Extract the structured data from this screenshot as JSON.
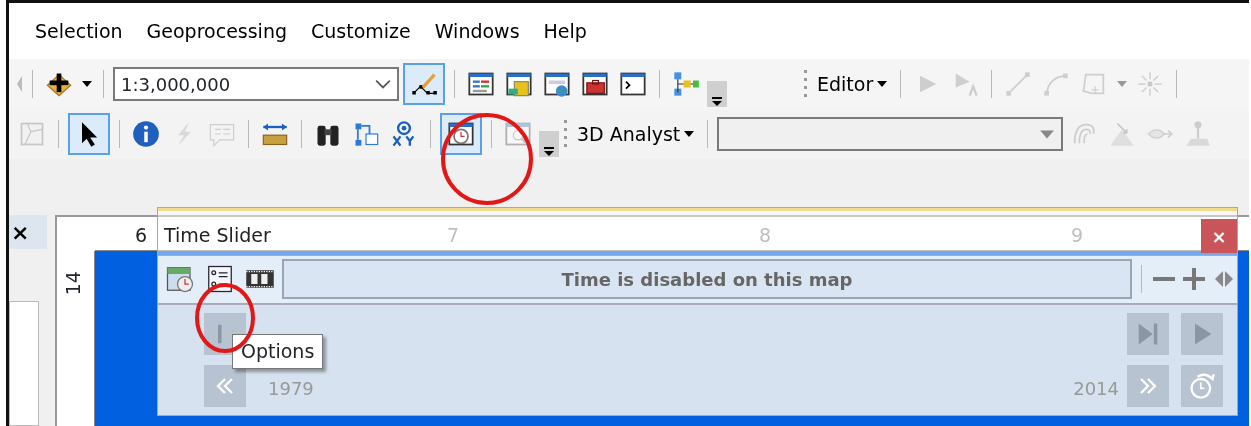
{
  "menu": [
    {
      "label": "Selection"
    },
    {
      "label": "Geoprocessing"
    },
    {
      "label": "Customize"
    },
    {
      "label": "Windows"
    },
    {
      "label": "Help"
    }
  ],
  "toolbar_row_1": [
    {
      "kind": "grip"
    },
    {
      "kind": "separator"
    },
    {
      "kind": "add",
      "selected": false,
      "disabled": false,
      "dropdown": true
    },
    {
      "kind": "separator"
    },
    {
      "kind": "combo",
      "value": "1:3,000,000",
      "disabled": false
    },
    {
      "kind": "edit",
      "selected": true,
      "disabled": false
    },
    {
      "kind": "separator"
    },
    {
      "kind": "toc",
      "selected": false,
      "disabled": false
    },
    {
      "kind": "catalog",
      "selected": false,
      "disabled": false
    },
    {
      "kind": "searchwin",
      "selected": false,
      "disabled": false
    },
    {
      "kind": "toolbox",
      "selected": false,
      "disabled": false
    },
    {
      "kind": "python",
      "selected": false,
      "disabled": false
    },
    {
      "kind": "separator"
    },
    {
      "kind": "model",
      "selected": false,
      "disabled": false
    },
    {
      "kind": "overflow"
    },
    {
      "kind": "gap"
    },
    {
      "kind": "handle"
    },
    {
      "kind": "menu",
      "label": "Editor"
    },
    {
      "kind": "separator"
    },
    {
      "kind": "editarrow",
      "selected": false,
      "disabled": true
    },
    {
      "kind": "annoarrow",
      "selected": false,
      "disabled": true
    },
    {
      "kind": "separator"
    },
    {
      "kind": "line",
      "selected": false,
      "disabled": true
    },
    {
      "kind": "trace",
      "selected": false,
      "disabled": true
    },
    {
      "kind": "polygon",
      "selected": false,
      "disabled": true,
      "dropdown": true
    },
    {
      "kind": "sparkle",
      "selected": false,
      "disabled": true
    },
    {
      "kind": "separator"
    }
  ],
  "toolbar_row_2": [
    {
      "kind": "frame",
      "selected": false,
      "disabled": true
    },
    {
      "kind": "separator"
    },
    {
      "kind": "select",
      "selected": true,
      "disabled": false
    },
    {
      "kind": "separator"
    },
    {
      "kind": "info",
      "selected": false,
      "disabled": false
    },
    {
      "kind": "flash",
      "selected": false,
      "disabled": true
    },
    {
      "kind": "popup",
      "selected": false,
      "disabled": true
    },
    {
      "kind": "separator"
    },
    {
      "kind": "measure",
      "selected": false,
      "disabled": false
    },
    {
      "kind": "separator"
    },
    {
      "kind": "find",
      "selected": false,
      "disabled": false
    },
    {
      "kind": "route",
      "selected": false,
      "disabled": false
    },
    {
      "kind": "xy",
      "selected": false,
      "disabled": false
    },
    {
      "kind": "separator"
    },
    {
      "kind": "timeslider",
      "selected": true,
      "disabled": false
    },
    {
      "kind": "separator"
    },
    {
      "kind": "viewer",
      "selected": false,
      "disabled": true
    },
    {
      "kind": "overflow"
    },
    {
      "kind": "handle"
    },
    {
      "kind": "menu",
      "label": "3D Analyst"
    },
    {
      "kind": "separator"
    },
    {
      "kind": "combo",
      "disabled": true
    },
    {
      "kind": "contour",
      "selected": false,
      "disabled": true
    },
    {
      "kind": "slope",
      "selected": false,
      "disabled": true
    },
    {
      "kind": "sight",
      "selected": false,
      "disabled": true
    },
    {
      "kind": "profile",
      "selected": false,
      "disabled": true
    }
  ],
  "dock_panel": {
    "close": "×"
  },
  "ruler": {
    "top_labels": [
      "6",
      "7",
      "8",
      "9"
    ],
    "side_labels": [
      "14"
    ]
  },
  "time_slider": {
    "title": "Time Slider",
    "close": "×",
    "toolbar": [
      {
        "kind": "timewin",
        "disabled": false
      },
      {
        "kind": "options",
        "disabled": false
      },
      {
        "kind": "film",
        "disabled": false
      }
    ],
    "status": "Time is disabled on this map",
    "zoom_buttons": [
      {
        "kind": "minus",
        "disabled": false
      },
      {
        "kind": "plus",
        "disabled": false
      },
      {
        "kind": "split",
        "disabled": false
      }
    ],
    "start_year": "1979",
    "end_year": "2014",
    "controls": [
      {
        "kind": "stepback",
        "disabled": true
      },
      {
        "kind": "back",
        "disabled": true
      },
      {
        "kind": "forward",
        "disabled": true
      },
      {
        "kind": "stepfwd",
        "disabled": true
      },
      {
        "kind": "play",
        "disabled": true
      },
      {
        "kind": "repeat",
        "disabled": true
      }
    ],
    "tooltip": "Options"
  },
  "highlight_circles": [
    {
      "kind": "circle"
    },
    {
      "kind": "circle"
    }
  ]
}
